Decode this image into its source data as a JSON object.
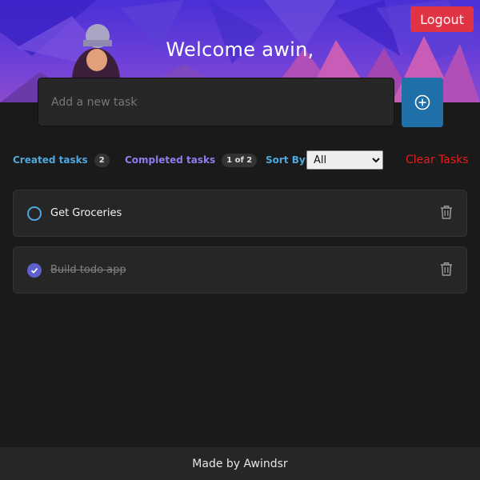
{
  "header": {
    "welcome": "Welcome awin,",
    "logout_label": "Logout"
  },
  "new_task": {
    "placeholder": "Add a new task",
    "value": "",
    "add_icon": "plus-circle-icon"
  },
  "toolbar": {
    "created_label": "Created tasks",
    "created_count": "2",
    "completed_label": "Completed tasks",
    "completed_count": "1 of 2",
    "sort_label": "Sort By",
    "sort_selected": "All",
    "clear_label": "Clear Tasks"
  },
  "tasks": [
    {
      "text": "Get Groceries",
      "completed": false
    },
    {
      "text": "Build todo app",
      "completed": true
    }
  ],
  "footer": {
    "text": "Made by Awindsr"
  },
  "colors": {
    "accent_blue": "#4ea8de",
    "accent_purple": "#5e60ce",
    "danger": "#e03445"
  }
}
